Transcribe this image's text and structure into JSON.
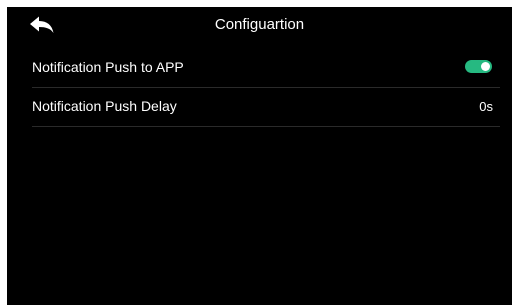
{
  "header": {
    "title": "Configuartion",
    "back_icon": "back-arrow-icon"
  },
  "settings": [
    {
      "label": "Notification Push to APP",
      "control": "toggle",
      "enabled": true
    },
    {
      "label": "Notification Push Delay",
      "control": "value",
      "value": "0s"
    }
  ],
  "colors": {
    "background": "#000000",
    "text": "#ffffff",
    "toggle_on": "#26b981",
    "divider": "#2a2a2a"
  }
}
